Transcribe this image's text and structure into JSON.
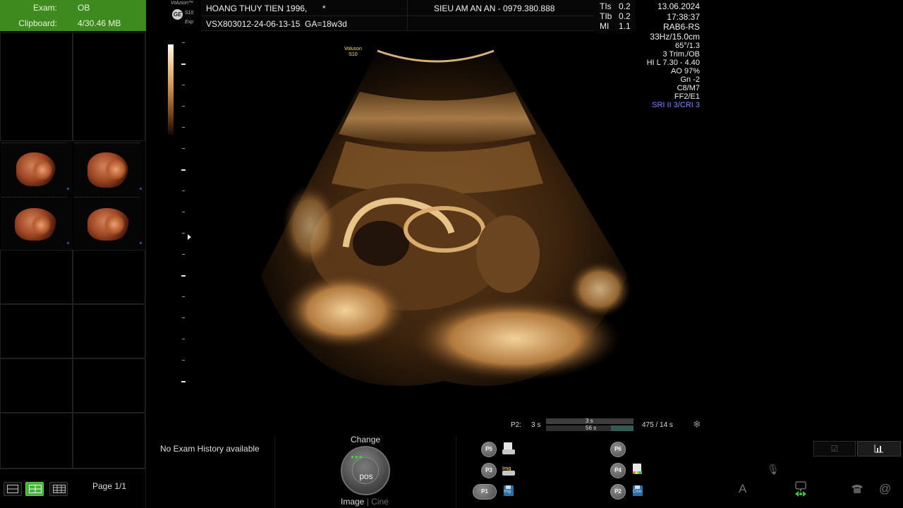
{
  "exam_panel": {
    "exam_label": "Exam:",
    "exam_value": "OB",
    "clipboard_label": "Clipboard:",
    "clipboard_value": "4/30.46 MB"
  },
  "page_label": "Page 1/1",
  "header": {
    "brand": "Voluson™",
    "logo_text": "GE",
    "model": "S10",
    "model_suffix": "Exp",
    "patient_name": "HOANG THUY TIEN 1996,",
    "patient_marker": "*",
    "exam_id": "VSX803012-24-06-13-15",
    "gestational_age": "GA=18w3d",
    "clinic": "SIEU AM AN AN - 0979.380.888",
    "tis_label": "TIs",
    "tis_value": "0.2",
    "tib_label": "TIb",
    "tib_value": "0.2",
    "mi_label": "MI",
    "mi_value": "1.1",
    "date": "13.06.2024",
    "time": "17:38:37",
    "probe": "RAB6-RS"
  },
  "params": {
    "frame_depth": "33Hz/15.0cm",
    "angle": "65°/1.3",
    "trim": "3 Trim./OB",
    "hil": "HI L  7.30 - 4.40",
    "ao": "AO 97%",
    "gn": "Gn  -2",
    "c_m": "C8/M7",
    "ff_e": "FF2/E1",
    "sri": "SRI II 3/CRI 3",
    "sri_color": "#7a86ff"
  },
  "voluson_mark": {
    "line1": "Voluson",
    "line2": "S10"
  },
  "cine": {
    "label": "P2:",
    "time1": "3 s",
    "bar_top": "3 s",
    "bar_bottom": "56 s",
    "frames": "475 / 14 s",
    "fill_fraction": 0.26
  },
  "bottom": {
    "no_history": "No Exam History available",
    "change_label": "Change",
    "knob_label": "pos",
    "image_label": "Image",
    "separator": "|",
    "cine_label": "Cine"
  },
  "print_buttons": {
    "p5": "P5",
    "p3": "P3",
    "p1": "P1",
    "p6": "P6",
    "p4": "P4",
    "p2": "P2",
    "img_text": "Img",
    "cine_text": "Cine"
  },
  "right_icons": {
    "check": "☑",
    "chart": "📊",
    "text_a": "A",
    "at": "@"
  },
  "colors": {
    "exam_green": "#3f8a1e",
    "active_layout": "#45b23a"
  }
}
